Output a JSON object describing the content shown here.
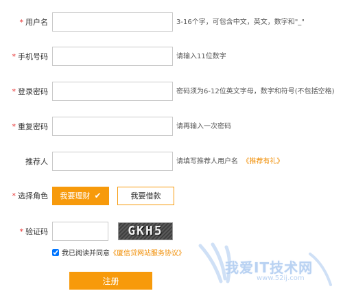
{
  "form": {
    "username": {
      "star": "*",
      "label": "用户名",
      "value": "",
      "hint": "3-16个字，可包含中文，英文，数字和\"_\""
    },
    "phone": {
      "star": "*",
      "label": "手机号码",
      "value": "",
      "hint": "请输入11位数字"
    },
    "password": {
      "star": "*",
      "label": "登录密码",
      "value": "",
      "hint": "密码须为6-12位英文字母，数字和符号(不包括空格)"
    },
    "password_repeat": {
      "star": "*",
      "label": "重复密码",
      "value": "",
      "hint": "请再输入一次密码"
    },
    "referrer": {
      "label": "推荐人",
      "value": "",
      "hint": "请填写推荐人用户名",
      "hint_link": "《推荐有礼》"
    },
    "role": {
      "star": "*",
      "label": "选择角色",
      "options": [
        "我要理财",
        "我要借款"
      ],
      "selected_icon": "check-icon"
    },
    "captcha": {
      "star": "*",
      "label": "验证码",
      "value": "",
      "image_text": "GKH5"
    },
    "agreement": {
      "text": "我已阅读并同意",
      "link": "《厦信贷网站服务协议》",
      "checked": true
    },
    "submit_label": "注册"
  },
  "watermark": {
    "text": "我爱IT技术网",
    "url": "www.52ij.com"
  },
  "colors": {
    "accent": "#f79a0b",
    "required": "#e62e2e",
    "link": "#f08c00"
  }
}
